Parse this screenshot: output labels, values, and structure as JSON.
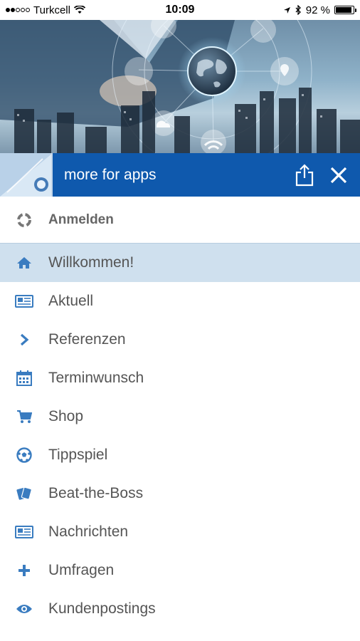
{
  "status_bar": {
    "carrier": "Turkcell",
    "time": "10:09",
    "battery_percent": "92 %",
    "battery_level": 0.92
  },
  "header": {
    "title": "more for apps",
    "share_icon": "share-icon",
    "close_icon": "close-icon"
  },
  "menu": {
    "login": {
      "label": "Anmelden",
      "icon": "login-icon"
    },
    "items": [
      {
        "label": "Willkommen!",
        "icon": "home-icon",
        "active": true
      },
      {
        "label": "Aktuell",
        "icon": "newspaper-icon"
      },
      {
        "label": "Referenzen",
        "icon": "chevron-right-icon"
      },
      {
        "label": "Terminwunsch",
        "icon": "calendar-icon"
      },
      {
        "label": "Shop",
        "icon": "cart-icon"
      },
      {
        "label": "Tippspiel",
        "icon": "soccer-ball-icon"
      },
      {
        "label": "Beat-the-Boss",
        "icon": "cards-icon"
      },
      {
        "label": "Nachrichten",
        "icon": "newspaper-icon"
      },
      {
        "label": "Umfragen",
        "icon": "plus-icon"
      },
      {
        "label": "Kundenpostings",
        "icon": "eye-icon"
      }
    ]
  },
  "colors": {
    "header_bg": "#0f59ad",
    "icon_blue": "#3a7cc0",
    "active_bg": "#cfe0ee"
  }
}
